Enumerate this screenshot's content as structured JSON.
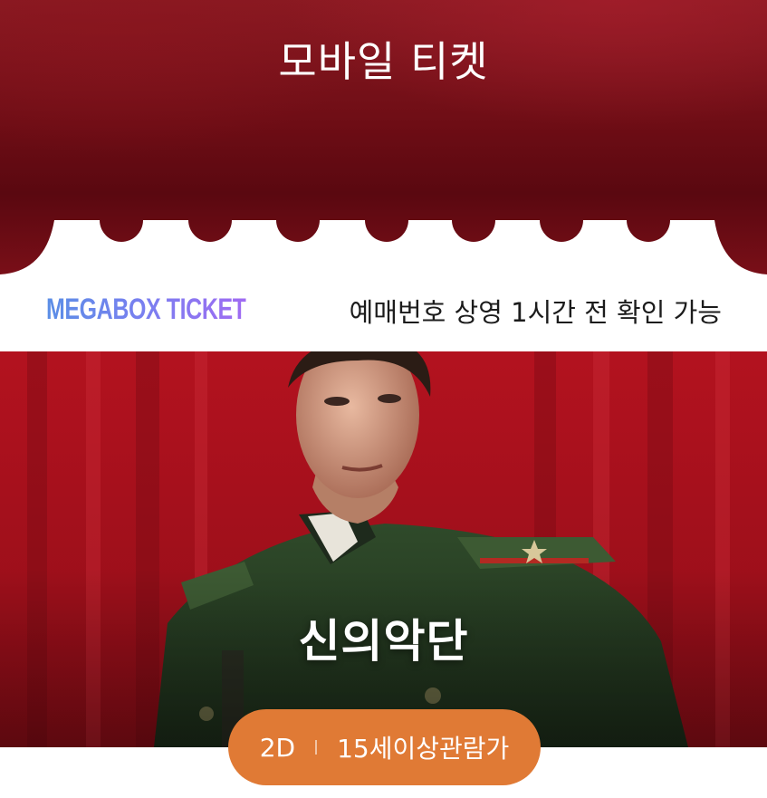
{
  "header": {
    "title": "모바일 티켓"
  },
  "ticket_info": {
    "brand": "MEGABOX TICKET",
    "notice": "예매번호 상영 1시간 전 확인 가능"
  },
  "movie": {
    "title": "신의악단",
    "format": "2D",
    "rating": "15세이상관람가"
  },
  "colors": {
    "header_red": "#6e0d15",
    "badge_orange": "#e07a35",
    "brand_gradient_start": "#5b8ee6",
    "brand_gradient_end": "#a06bf2"
  }
}
